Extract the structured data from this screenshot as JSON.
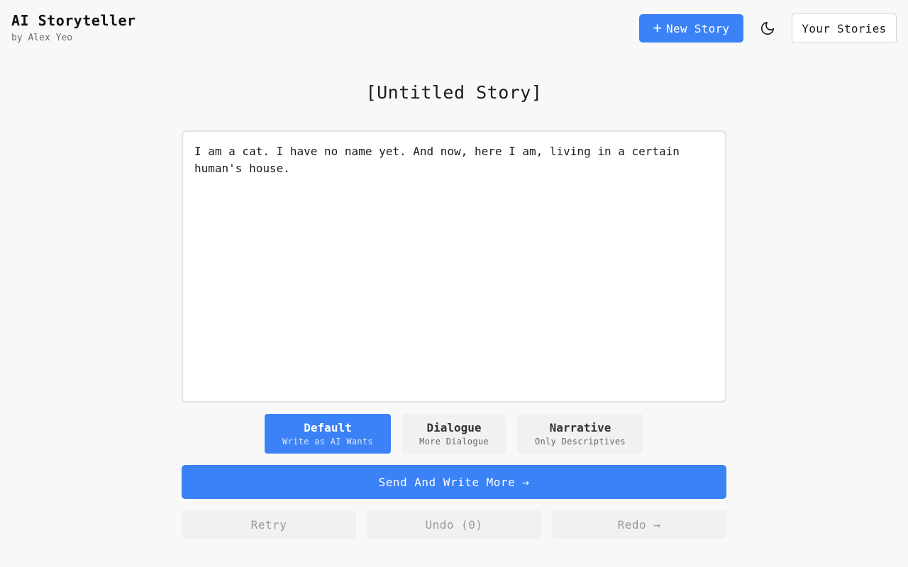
{
  "header": {
    "title": "AI Storyteller",
    "subtitle": "by Alex Yeo",
    "new_story_label": "New Story",
    "new_story_icon": "+",
    "theme_icon": "moon-icon",
    "your_stories_label": "Your Stories"
  },
  "story": {
    "title": "[Untitled Story]",
    "text": "I am a cat. I have no name yet. And now, here I am, living in a certain human's house."
  },
  "modes": [
    {
      "label": "Default",
      "sub": "Write as AI Wants",
      "active": true
    },
    {
      "label": "Dialogue",
      "sub": "More Dialogue",
      "active": false
    },
    {
      "label": "Narrative",
      "sub": "Only Descriptives",
      "active": false
    }
  ],
  "actions": {
    "send_label": "Send And Write More →",
    "retry_label": "Retry",
    "undo_label": "Undo (0)",
    "redo_label": "Redo →"
  },
  "colors": {
    "accent": "#3b82f6",
    "background": "#f8f8f8",
    "disabled_bg": "#f1f1f1",
    "disabled_text": "#9a9a9a"
  }
}
